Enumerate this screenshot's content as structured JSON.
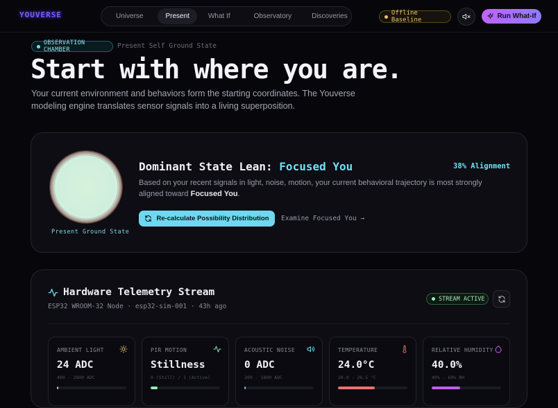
{
  "app": {
    "logo": "YOUVERSE"
  },
  "nav": {
    "items": [
      "Universe",
      "Present",
      "What If",
      "Observatory",
      "Discoveries"
    ],
    "active": "Present"
  },
  "header": {
    "offline_label": "Offline Baseline",
    "run_label": "Run What-If"
  },
  "chamber": {
    "badge": "OBSERVATION CHAMBER",
    "subtitle": "Present Self Ground State"
  },
  "hero": {
    "headline": "Start with where you are.",
    "lede": "Your current environment and behaviors form the starting coordinates. The Youverse modeling engine translates sensor signals into a living superposition."
  },
  "lean": {
    "orb_label": "Present Ground State",
    "title_prefix": "Dominant State Lean: ",
    "title_state": "Focused You",
    "alignment": "38% Alignment",
    "desc_prefix": "Based on your recent signals in light, noise, motion, your current behavioral trajectory is most strongly aligned toward ",
    "desc_state": "Focused You",
    "desc_suffix": ".",
    "recalc_label": "Re-calculate Possibility Distribution",
    "examine_label": "Examine Focused You →"
  },
  "telemetry": {
    "title": "Hardware Telemetry Stream",
    "subtitle": "ESP32 WROOM-32 Node · esp32-sim-001 · 43h ago",
    "stream_badge": "STREAM ACTIVE",
    "sensors": [
      {
        "label": "AMBIENT LIGHT",
        "icon": "sun-icon",
        "value": "24 ADC",
        "range": "400 - 2800 ADC",
        "level": 0.02,
        "color": "#cfcfd6"
      },
      {
        "label": "PIR MOTION",
        "icon": "activity-icon",
        "value": "Stillness",
        "range": "0 (Still) / 1 (Active)",
        "level": 0.1,
        "color": "#8ff0b4"
      },
      {
        "label": "ACOUSTIC NOISE",
        "icon": "speaker-icon",
        "value": "0 ADC",
        "range": "200 - 1800 ADC",
        "level": 0.0,
        "color": "#6fd8f0"
      },
      {
        "label": "TEMPERATURE",
        "icon": "thermometer-icon",
        "value": "24.0°C",
        "range": "20.0 - 26.5 °C",
        "level": 0.53,
        "color": "#f07070"
      },
      {
        "label": "RELATIVE HUMIDITY",
        "icon": "droplet-icon",
        "value": "40.0%",
        "range": "40% - 60% RH",
        "level": 0.41,
        "color": "#c45cf0"
      }
    ]
  },
  "colors": {
    "accent_cyan": "#6fe0f3",
    "accent_purple": "#c062ff",
    "offline_gold": "#e8c36a",
    "stream_green": "#9fe9b8"
  }
}
